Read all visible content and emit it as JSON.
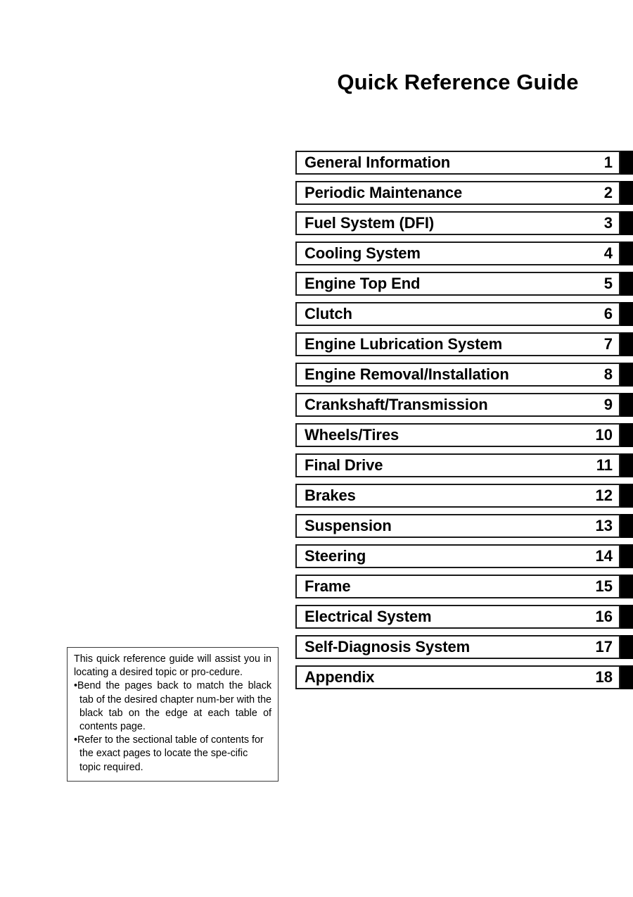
{
  "document": {
    "title": "Quick Reference Guide"
  },
  "chapters": [
    {
      "title": "General Information",
      "number": "1"
    },
    {
      "title": "Periodic Maintenance",
      "number": "2"
    },
    {
      "title": "Fuel System (DFI)",
      "number": "3"
    },
    {
      "title": "Cooling System",
      "number": "4"
    },
    {
      "title": "Engine Top End",
      "number": "5"
    },
    {
      "title": "Clutch",
      "number": "6"
    },
    {
      "title": "Engine Lubrication System",
      "number": "7"
    },
    {
      "title": "Engine Removal/Installation",
      "number": "8"
    },
    {
      "title": "Crankshaft/Transmission",
      "number": "9"
    },
    {
      "title": "Wheels/Tires",
      "number": "10"
    },
    {
      "title": "Final Drive",
      "number": "11"
    },
    {
      "title": "Brakes",
      "number": "12"
    },
    {
      "title": "Suspension",
      "number": "13"
    },
    {
      "title": "Steering",
      "number": "14"
    },
    {
      "title": "Frame",
      "number": "15"
    },
    {
      "title": "Electrical System",
      "number": "16"
    },
    {
      "title": "Self-Diagnosis System",
      "number": "17"
    },
    {
      "title": "Appendix",
      "number": "18"
    }
  ],
  "note": {
    "intro": "This quick reference guide will assist you in locating a desired topic or pro-cedure.",
    "bullets": [
      "Bend the pages back to match the black tab of the desired chapter num-ber with the black tab on the edge at each table of contents page.",
      "Refer to the sectional table of contents for the exact pages to locate the spe-cific topic required."
    ],
    "bullet_glyph": "•"
  },
  "colors": {
    "tab_black": "#000000",
    "border": "#1a1a1a",
    "page_background": "#ffffff",
    "text": "#000000"
  }
}
